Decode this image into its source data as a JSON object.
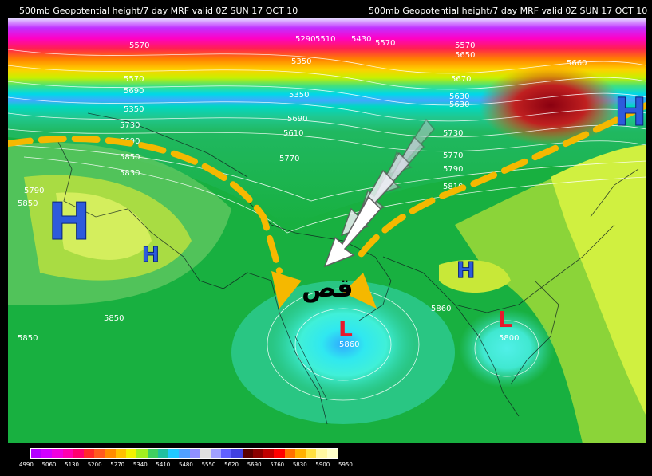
{
  "header": {
    "title_left": "500mb Geopotential height/7 day MRF valid 0Z SUN 17 OCT 10",
    "title_right": "500mb Geopotential height/7 day MRF valid 0Z SUN 17 OCT 10"
  },
  "map": {
    "contour_labels": [
      "5570",
      "5290",
      "5350",
      "5510",
      "5430",
      "5570",
      "5350",
      "5570",
      "5650",
      "5570",
      "5690",
      "5660",
      "5670",
      "5350",
      "5690",
      "5730",
      "5610",
      "5690",
      "5630",
      "5630",
      "5790",
      "5770",
      "5730",
      "5770",
      "5790",
      "5810",
      "5850",
      "5860",
      "5850",
      "5850",
      "5860",
      "5830",
      "5850",
      "5800"
    ],
    "highs": [
      "H",
      "H",
      "H",
      "H"
    ],
    "lows": [
      "L",
      "L"
    ],
    "arabic_label": "قص",
    "colors": {
      "trough_arrow": "#f5b800",
      "arrow_fill": "#ffffff",
      "high_marker": "#2d5bdc",
      "low_marker": "#e8182c"
    }
  },
  "colorbar": {
    "labels": [
      "4990",
      "5060",
      "5130",
      "5200",
      "5270",
      "5340",
      "5410",
      "5480",
      "5550",
      "5620",
      "5690",
      "5760",
      "5830",
      "5900",
      "5950"
    ],
    "colors": [
      "#b400ff",
      "#d200ff",
      "#f000e0",
      "#ff00b0",
      "#ff0070",
      "#ff2a2a",
      "#ff5a1e",
      "#ff8c00",
      "#ffc000",
      "#f2f200",
      "#a0f020",
      "#40d060",
      "#20c0a0",
      "#20c8ff",
      "#50a0ff",
      "#9090ff",
      "#e0e0e0",
      "#a0a0ff",
      "#6060ff",
      "#4040e0",
      "#5a0000",
      "#8a0000",
      "#c00000",
      "#ff0000",
      "#ff7000",
      "#ffb000",
      "#ffe040",
      "#fff8a0",
      "#ffffc8"
    ]
  }
}
